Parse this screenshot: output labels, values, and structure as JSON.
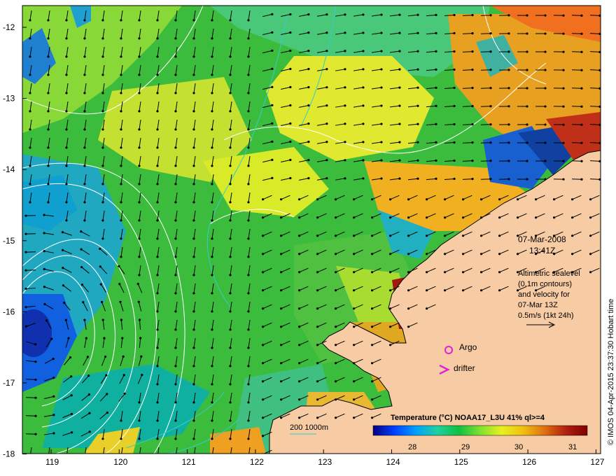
{
  "map": {
    "date": "07-Mar-2008",
    "time": "13:41Z",
    "altimetry_lines": [
      "Altimetric sealevel",
      "(0.1m contours)",
      "and velocity for",
      "07-Mar 13Z",
      "0.5m/s (1kt 24h)"
    ],
    "argo_label": "Argo",
    "drifter_label": "drifter",
    "depth_legend": "200  1000m",
    "colorbar_title": "Temperature (°C) NOAA17_L3U 41% ql>=4",
    "colorbar_ticks": [
      "28",
      "29",
      "30",
      "31"
    ],
    "credit": "© IMOS 04-Apr-2015 23:37:30 Hobart time",
    "x_ticks": [
      "119",
      "120",
      "121",
      "122",
      "123",
      "124",
      "125",
      "126",
      "127"
    ],
    "y_ticks": [
      "-12",
      "-13",
      "-14",
      "-15",
      "-16",
      "-17",
      "-18"
    ],
    "colors": {
      "land": "#f7cba3",
      "argo": "#e020e0",
      "drifter": "#e020e0",
      "contour": "#ffffff",
      "isobath": "#33cccc",
      "arrow": "#000000"
    },
    "colorbar_colors": [
      "#000080",
      "#0040ff",
      "#00a0ff",
      "#20d0a0",
      "#10c040",
      "#80e030",
      "#e8f020",
      "#f0c010",
      "#e07010",
      "#b02010",
      "#800000"
    ]
  }
}
